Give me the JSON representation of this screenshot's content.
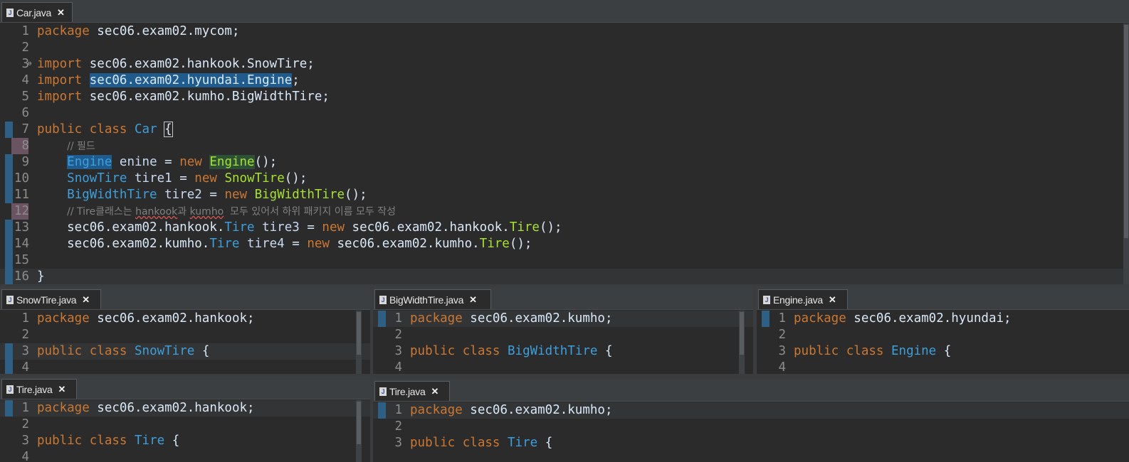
{
  "panes": {
    "car": {
      "tab": "Car.java",
      "lines": [
        {
          "n": "1",
          "tokens": [
            {
              "t": "package",
              "c": "kw"
            },
            {
              "t": " sec06.exam02.mycom;"
            }
          ]
        },
        {
          "n": "2",
          "tokens": []
        },
        {
          "n": "3",
          "tokens": [
            {
              "t": "import",
              "c": "kw"
            },
            {
              "t": " sec06.exam02.hankook.SnowTire;"
            }
          ]
        },
        {
          "n": "4",
          "tokens": [
            {
              "t": "import",
              "c": "kw"
            },
            {
              "t": " "
            },
            {
              "t": "sec06.exam02.hyundai.Engine",
              "c": "sel"
            },
            {
              "t": ";"
            }
          ]
        },
        {
          "n": "5",
          "tokens": [
            {
              "t": "import",
              "c": "kw"
            },
            {
              "t": " sec06.exam02.kumho.BigWidthTire;"
            }
          ]
        },
        {
          "n": "6",
          "tokens": []
        },
        {
          "n": "7",
          "tokens": [
            {
              "t": "public",
              "c": "kw"
            },
            {
              "t": " "
            },
            {
              "t": "class",
              "c": "kw"
            },
            {
              "t": " "
            },
            {
              "t": "Car",
              "c": "ty"
            },
            {
              "t": " "
            },
            {
              "t": "{",
              "c": "brace"
            }
          ]
        },
        {
          "n": "8",
          "tokens": [
            {
              "t": "    "
            },
            {
              "t": "// 필드",
              "c": "cm"
            }
          ]
        },
        {
          "n": "9",
          "tokens": [
            {
              "t": "    "
            },
            {
              "t": "Engine",
              "c": "ty sel"
            },
            {
              "t": " "
            },
            {
              "t": "enine",
              "c": "fld"
            },
            {
              "t": " = "
            },
            {
              "t": "new",
              "c": "kw"
            },
            {
              "t": " "
            },
            {
              "t": "Engine",
              "c": "ctor hl"
            },
            {
              "t": "();"
            }
          ]
        },
        {
          "n": "10",
          "tokens": [
            {
              "t": "    "
            },
            {
              "t": "SnowTire",
              "c": "ty"
            },
            {
              "t": " "
            },
            {
              "t": "tire1",
              "c": "fld"
            },
            {
              "t": " = "
            },
            {
              "t": "new",
              "c": "kw"
            },
            {
              "t": " "
            },
            {
              "t": "SnowTire",
              "c": "ctor"
            },
            {
              "t": "();"
            }
          ]
        },
        {
          "n": "11",
          "tokens": [
            {
              "t": "    "
            },
            {
              "t": "BigWidthTire",
              "c": "ty"
            },
            {
              "t": " "
            },
            {
              "t": "tire2",
              "c": "fld"
            },
            {
              "t": " = "
            },
            {
              "t": "new",
              "c": "kw"
            },
            {
              "t": " "
            },
            {
              "t": "BigWidthTire",
              "c": "ctor"
            },
            {
              "t": "();"
            }
          ]
        },
        {
          "n": "12",
          "tokens": [
            {
              "t": "    "
            },
            {
              "t": "// ",
              "c": "cm"
            },
            {
              "t": "Tire",
              "c": "cm"
            },
            {
              "t": "클래스는 ",
              "c": "cm"
            },
            {
              "t": "hankook",
              "c": "cm sq"
            },
            {
              "t": "과 ",
              "c": "cm"
            },
            {
              "t": "kumho",
              "c": "cm sq"
            },
            {
              "t": "  모두 있어서 하위 패키지 이름 모두 작성",
              "c": "cm"
            }
          ]
        },
        {
          "n": "13",
          "tokens": [
            {
              "t": "    sec06.exam02.hankook."
            },
            {
              "t": "Tire",
              "c": "ty"
            },
            {
              "t": " "
            },
            {
              "t": "tire3",
              "c": "fld"
            },
            {
              "t": " = "
            },
            {
              "t": "new",
              "c": "kw"
            },
            {
              "t": " sec06.exam02.hankook."
            },
            {
              "t": "Tire",
              "c": "ctor"
            },
            {
              "t": "();"
            }
          ]
        },
        {
          "n": "14",
          "tokens": [
            {
              "t": "    sec06.exam02.kumho."
            },
            {
              "t": "Tire",
              "c": "ty"
            },
            {
              "t": " "
            },
            {
              "t": "tire4",
              "c": "fld"
            },
            {
              "t": " = "
            },
            {
              "t": "new",
              "c": "kw"
            },
            {
              "t": " sec06.exam02.kumho."
            },
            {
              "t": "Tire",
              "c": "ctor"
            },
            {
              "t": "();"
            }
          ]
        },
        {
          "n": "15",
          "tokens": []
        },
        {
          "n": "16",
          "tokens": [
            {
              "t": "}"
            }
          ]
        }
      ]
    },
    "snowtire": {
      "tab": "SnowTire.java",
      "lines": [
        {
          "n": "1",
          "tokens": [
            {
              "t": "package",
              "c": "kw"
            },
            {
              "t": " sec06.exam02.hankook;"
            }
          ]
        },
        {
          "n": "2",
          "tokens": []
        },
        {
          "n": "3",
          "tokens": [
            {
              "t": "public",
              "c": "kw"
            },
            {
              "t": " "
            },
            {
              "t": "class",
              "c": "kw"
            },
            {
              "t": " "
            },
            {
              "t": "SnowTire",
              "c": "ty"
            },
            {
              "t": " {"
            }
          ]
        },
        {
          "n": "4",
          "tokens": []
        }
      ]
    },
    "bigwidth": {
      "tab": "BigWidthTire.java",
      "lines": [
        {
          "n": "1",
          "tokens": [
            {
              "t": "package",
              "c": "kw"
            },
            {
              "t": " sec06.exam02.kumho;"
            }
          ]
        },
        {
          "n": "2",
          "tokens": []
        },
        {
          "n": "3",
          "tokens": [
            {
              "t": "public",
              "c": "kw"
            },
            {
              "t": " "
            },
            {
              "t": "class",
              "c": "kw"
            },
            {
              "t": " "
            },
            {
              "t": "BigWidthTire",
              "c": "ty"
            },
            {
              "t": " {"
            }
          ]
        },
        {
          "n": "4",
          "tokens": []
        }
      ]
    },
    "engine": {
      "tab": "Engine.java",
      "lines": [
        {
          "n": "1",
          "tokens": [
            {
              "t": "package",
              "c": "kw"
            },
            {
              "t": " sec06.exam02.hyundai;"
            }
          ]
        },
        {
          "n": "2",
          "tokens": []
        },
        {
          "n": "3",
          "tokens": [
            {
              "t": "public",
              "c": "kw"
            },
            {
              "t": " "
            },
            {
              "t": "class",
              "c": "kw"
            },
            {
              "t": " "
            },
            {
              "t": "Engine",
              "c": "ty"
            },
            {
              "t": " {"
            }
          ]
        },
        {
          "n": "4",
          "tokens": []
        }
      ]
    },
    "tire_hankook": {
      "tab": "Tire.java",
      "lines": [
        {
          "n": "1",
          "tokens": [
            {
              "t": "package",
              "c": "kw"
            },
            {
              "t": " sec06.exam02.hankook;"
            }
          ]
        },
        {
          "n": "2",
          "tokens": []
        },
        {
          "n": "3",
          "tokens": [
            {
              "t": "public",
              "c": "kw"
            },
            {
              "t": " "
            },
            {
              "t": "class",
              "c": "kw"
            },
            {
              "t": " "
            },
            {
              "t": "Tire",
              "c": "ty"
            },
            {
              "t": " {"
            }
          ]
        },
        {
          "n": "4",
          "tokens": []
        }
      ]
    },
    "tire_kumho": {
      "tab": "Tire.java",
      "lines": [
        {
          "n": "1",
          "tokens": [
            {
              "t": "package",
              "c": "kw"
            },
            {
              "t": " sec06.exam02.kumho;"
            }
          ]
        },
        {
          "n": "2",
          "tokens": []
        },
        {
          "n": "3",
          "tokens": [
            {
              "t": "public",
              "c": "kw"
            },
            {
              "t": " "
            },
            {
              "t": "class",
              "c": "kw"
            },
            {
              "t": " "
            },
            {
              "t": "Tire",
              "c": "ty"
            },
            {
              "t": " {"
            }
          ]
        }
      ]
    }
  },
  "close_glyph": "✕",
  "file_icon_glyph": "J",
  "fold_glyph": "⊖",
  "colors": {
    "keyword": "#cc7832",
    "type": "#3d9fdc",
    "constructor": "#a6e22e",
    "comment": "#808080",
    "background": "#2b2b2b"
  }
}
